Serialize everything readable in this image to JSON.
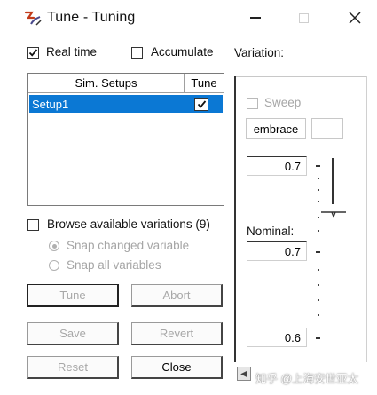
{
  "window": {
    "title": "Tune - Tuning",
    "icon": "tuning-app-icon",
    "controls": {
      "minimize": "minimize-icon",
      "maximize": "maximize-icon",
      "close": "close-icon"
    }
  },
  "options": {
    "real_time": {
      "label": "Real time",
      "checked": true
    },
    "accumulate": {
      "label": "Accumulate",
      "checked": false
    },
    "variation_label": "Variation:"
  },
  "setups": {
    "columns": [
      "Sim. Setups",
      "Tune"
    ],
    "rows": [
      {
        "name": "Setup1",
        "tune": true,
        "selected": true
      }
    ]
  },
  "browse": {
    "label": "Browse available variations (9)",
    "checked": false,
    "snap_changed": {
      "label": "Snap changed variable",
      "selected": true,
      "enabled": false
    },
    "snap_all": {
      "label": "Snap all variables",
      "selected": false,
      "enabled": false
    }
  },
  "buttons": {
    "tune": "Tune",
    "abort": "Abort",
    "save": "Save",
    "revert": "Revert",
    "reset": "Reset",
    "close": "Close"
  },
  "variable_panel": {
    "sweep": {
      "label": "Sweep",
      "checked": false,
      "enabled": false
    },
    "variable_name": "embrace",
    "max_value": "0.7",
    "nominal_label": "Nominal:",
    "nominal_value": "0.7",
    "min_value": "0.6"
  },
  "watermark": "知乎 @上海安世亚太",
  "colors": {
    "selection": "#0b78d4",
    "disabled_text": "#a8a8a8"
  }
}
